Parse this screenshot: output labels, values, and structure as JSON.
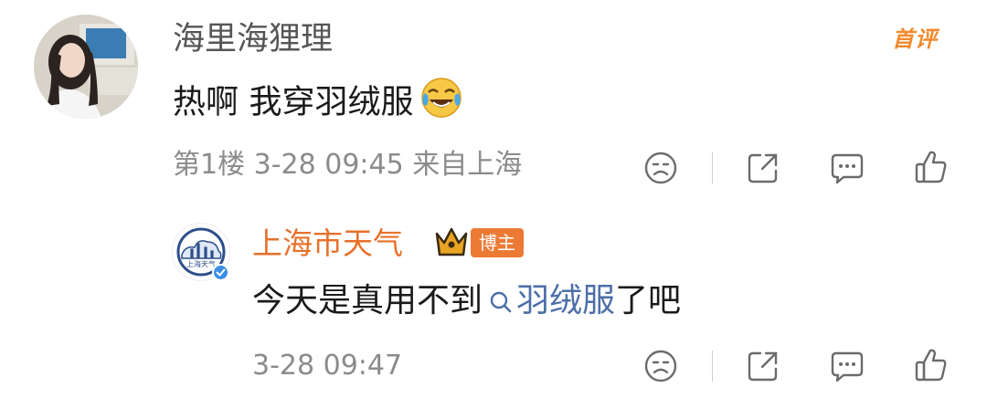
{
  "comment": {
    "username": "海里海狸理",
    "badge": "首评",
    "text": "热啊 我穿羽绒服",
    "emoji": "laughing-crying-emoji",
    "floor": "第1楼",
    "time": "3-28 09:45",
    "location": "来自上海"
  },
  "reply": {
    "username": "上海市天气",
    "role_badge": "博主",
    "text_before": "今天是真用不到",
    "topic_link": "羽绒服",
    "text_after": "了吧",
    "time": "3-28 09:47"
  },
  "actions": [
    "dislike-icon",
    "share-icon",
    "comment-icon",
    "like-icon"
  ],
  "colors": {
    "username_reply": "#e7702a",
    "badge_first": "#f28a2e",
    "topic": "#4c6fa8",
    "meta": "#8b8b8b",
    "verified": "#3a8ee6"
  }
}
